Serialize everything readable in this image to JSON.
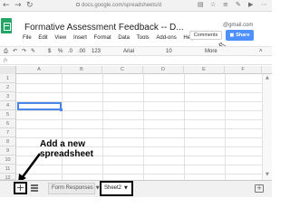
{
  "browser": {
    "back_icon": "back-arrow-icon",
    "forward_icon": "forward-arrow-icon",
    "refresh_icon": "refresh-icon",
    "url": "docs.google.com/spreadsheets/d",
    "reading_view_icon": "reading-view-icon",
    "favorites_icon": "star-icon",
    "hub_icon": "hub-icon",
    "share_icon": "pen-icon"
  },
  "sheet": {
    "logo_icon": "sheets-logo-icon",
    "title": "Formative Assessment Feedback -- D...",
    "owner_email": "@gmail.com",
    "menu": [
      "File",
      "Edit",
      "View",
      "Insert",
      "Format",
      "Data",
      "Tools",
      "Add-ons",
      "Help"
    ],
    "comments_label": "Comments",
    "share_label": "Share",
    "share_icon": "lock-icon",
    "accent_color": "#4d90fe",
    "logo_color": "#22a565"
  },
  "toolbar": {
    "print_icon": "print-icon",
    "undo_icon": "undo-icon",
    "redo_icon": "redo-icon",
    "paint_format_icon": "paint-format-icon",
    "currency": "$",
    "percent": "%",
    "decimal_dec": ".0",
    "decimal_inc": ".00",
    "number_format": "123",
    "font": "Arial",
    "font_size": "10",
    "more_label": "More",
    "collapse_icon": "chevron-up-icon"
  },
  "formula_bar": {
    "fx_label": "fx"
  },
  "grid": {
    "columns": [
      "A",
      "B",
      "C",
      "D",
      "E",
      "F"
    ],
    "rows": [
      "1",
      "2",
      "3",
      "4",
      "5",
      "6",
      "7",
      "8",
      "9",
      "10",
      "11",
      "12"
    ],
    "selected_cell": "A4"
  },
  "annotation": {
    "text": "Add a new spreadsheet"
  },
  "tabs": {
    "add_label": "+",
    "add_icon": "plus-icon",
    "all_sheets_icon": "list-icon",
    "items": [
      {
        "label": "Form Responses"
      },
      {
        "label": "Sheet2"
      }
    ],
    "explore_icon": "explore-icon"
  }
}
